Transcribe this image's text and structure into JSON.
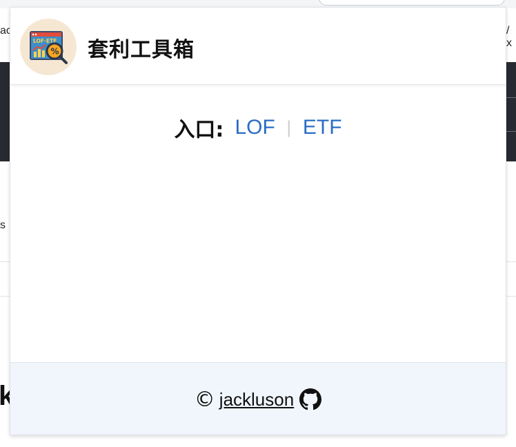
{
  "app": {
    "title": "套利工具箱",
    "logo_text": "LOF·ETF"
  },
  "entry": {
    "label": "入口:",
    "links": [
      "LOF",
      "ETF"
    ],
    "separator": "|"
  },
  "footer": {
    "copyright_symbol": "©",
    "author": "jackluson"
  },
  "background_fragments": {
    "left_top": "ac",
    "right_top": "/ x",
    "left_mid": "s",
    "left_bottom": "k"
  },
  "colors": {
    "link": "#2a6cc4",
    "footer_bg": "#f1f6fc",
    "logo_bg": "#f6e7d3",
    "dark_band": "#272b31"
  }
}
